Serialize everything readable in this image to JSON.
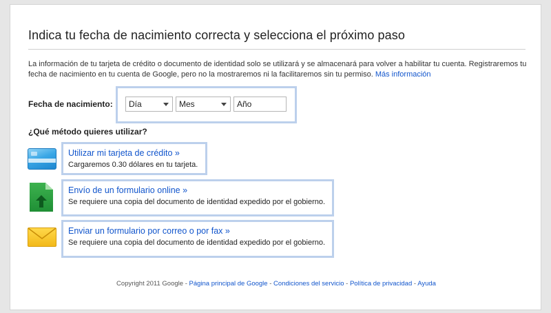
{
  "header": {
    "title": "Indica tu fecha de nacimiento correcta y selecciona el próximo paso"
  },
  "intro": {
    "text": "La información de tu tarjeta de crédito o documento de identidad solo se utilizará y se almacenará para volver a habilitar tu cuenta. Registraremos tu fecha de nacimiento en tu cuenta de Google, pero no la mostraremos ni la facilitaremos sin tu permiso.",
    "link": "Más información"
  },
  "dob": {
    "label": "Fecha de nacimiento:",
    "day": "Día",
    "month": "Mes",
    "year_placeholder": "Año"
  },
  "methods": {
    "question": "¿Qué método quieres utilizar?",
    "items": [
      {
        "title": "Utilizar mi tarjeta de crédito »",
        "desc": "Cargaremos 0.30 dólares en tu tarjeta.",
        "icon": "credit-card-icon"
      },
      {
        "title": "Envío de un formulario online »",
        "desc": "Se requiere una copia del documento de identidad expedido por el gobierno.",
        "icon": "upload-document-icon"
      },
      {
        "title": "Enviar un formulario por correo o por fax »",
        "desc": "Se requiere una copia del documento de identidad expedido por el gobierno.",
        "icon": "envelope-icon"
      }
    ]
  },
  "footer": {
    "copyright": "Copyright 2011 Google",
    "links": [
      "Página principal de Google",
      "Condiciones del servicio",
      "Política de privacidad",
      "Ayuda"
    ]
  },
  "colors": {
    "link": "#1155cc",
    "box_border": "#bcd0ec"
  }
}
